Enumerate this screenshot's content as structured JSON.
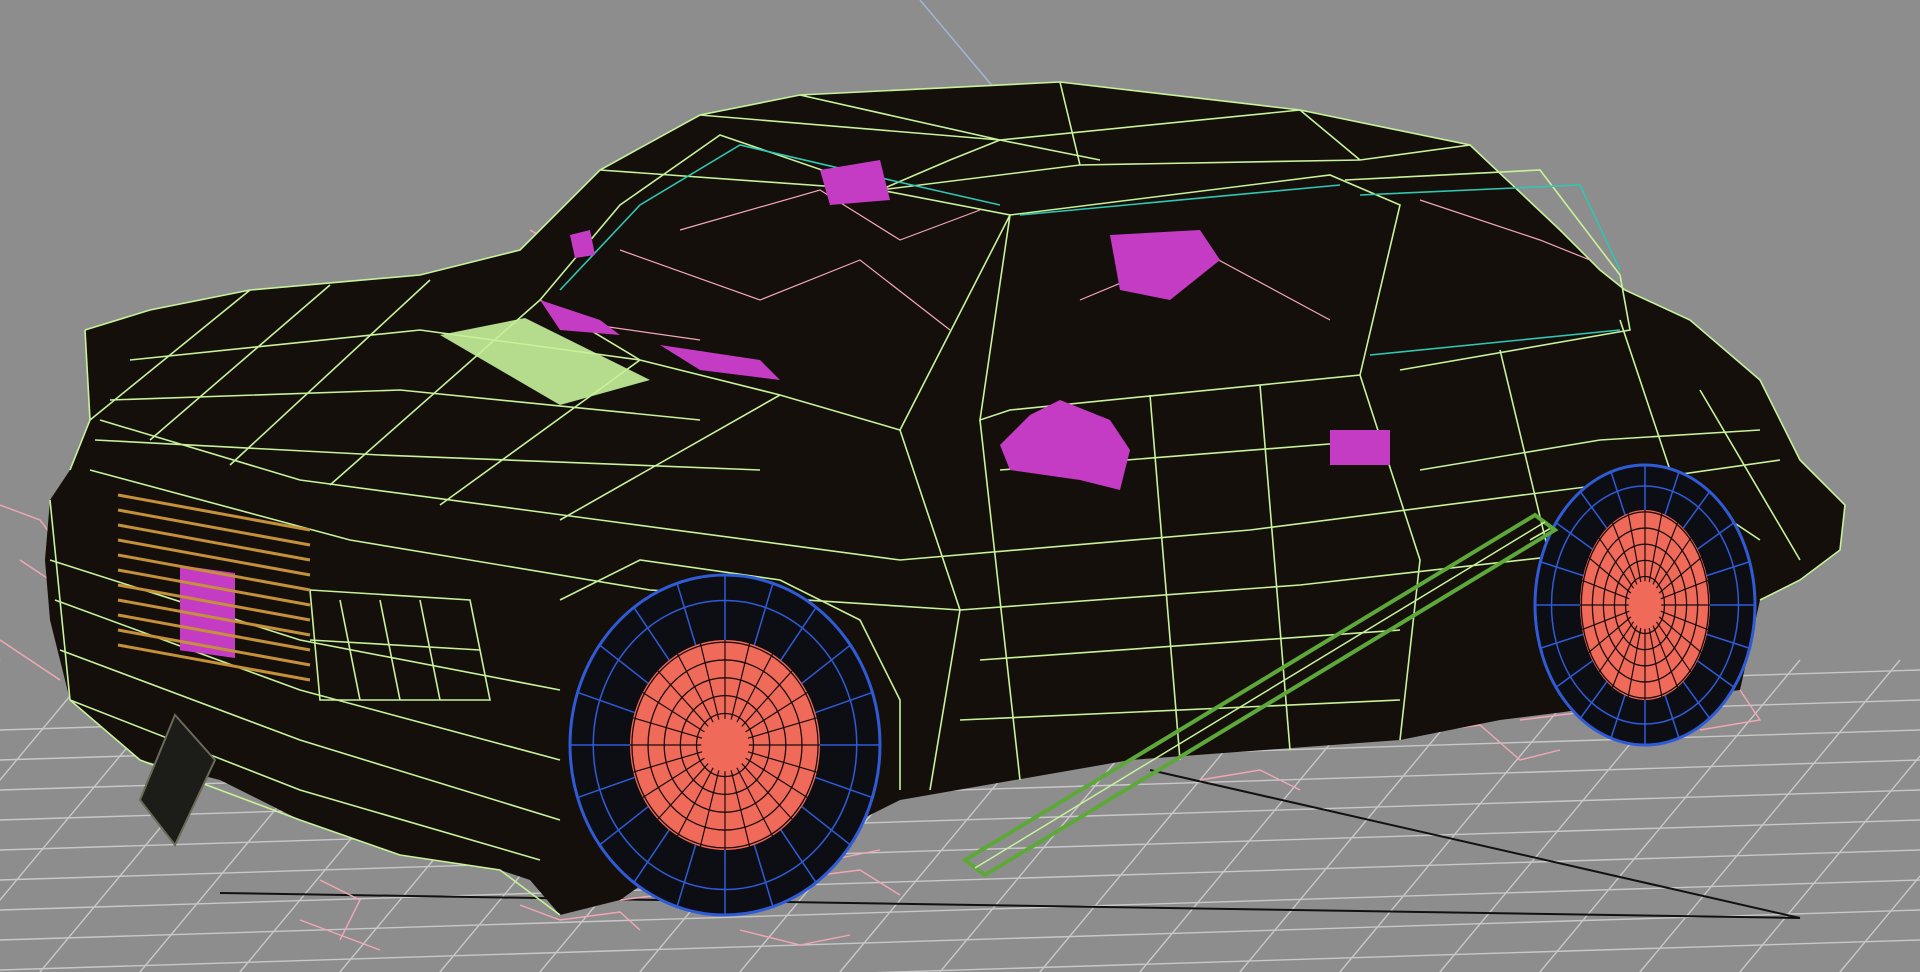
{
  "viewport": {
    "background_color": "#8d8d8d",
    "grid_color": "#c8c8c8",
    "axis_color": "#111111",
    "y_axis_color": "#9fb6d8"
  },
  "model": {
    "body_color": "#140f0b",
    "shell_wire_color": "#c7f29a",
    "wheel_wire_color": "#2f5bd6",
    "rim_color": "#f06a5a",
    "glass_wire_color": "#2fc7b2",
    "interior_color": "#c43cc4",
    "grille_color": "#c4913a",
    "rail_color": "#5ea83a",
    "rig_color": "#f2a7b5"
  }
}
